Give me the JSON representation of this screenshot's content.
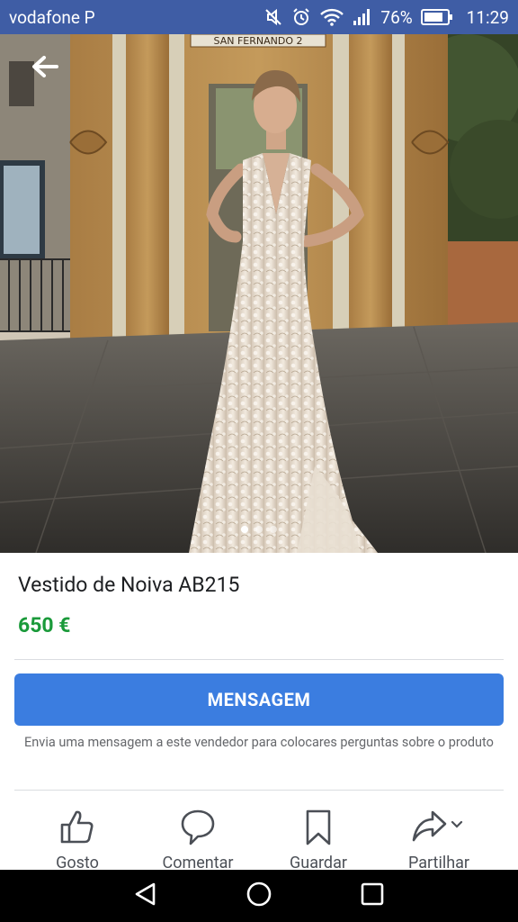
{
  "status_bar": {
    "carrier": "vodafone P",
    "battery": "76%",
    "time": "11:29",
    "icons": [
      "mute-icon",
      "alarm-icon",
      "wifi-icon",
      "signal-icon",
      "battery-icon"
    ]
  },
  "hero": {
    "sign_text": "SAN FERNANDO 2",
    "image_count": 3,
    "active_image": 1
  },
  "listing": {
    "title": "Vestido de Noiva AB215",
    "price": "650 €",
    "price_color": "#1a9a3a"
  },
  "message": {
    "button_label": "MENSAGEM",
    "button_color": "#3b7de0",
    "hint": "Envia uma mensagem a este vendedor para colocares perguntas sobre o produto"
  },
  "actions": [
    {
      "label": "Gosto",
      "icon": "thumbs-up-icon"
    },
    {
      "label": "Comentar",
      "icon": "comment-icon"
    },
    {
      "label": "Guardar",
      "icon": "bookmark-icon"
    },
    {
      "label": "Partilhar",
      "icon": "share-icon"
    }
  ],
  "nav": [
    "back-nav-icon",
    "home-nav-icon",
    "recents-nav-icon"
  ]
}
